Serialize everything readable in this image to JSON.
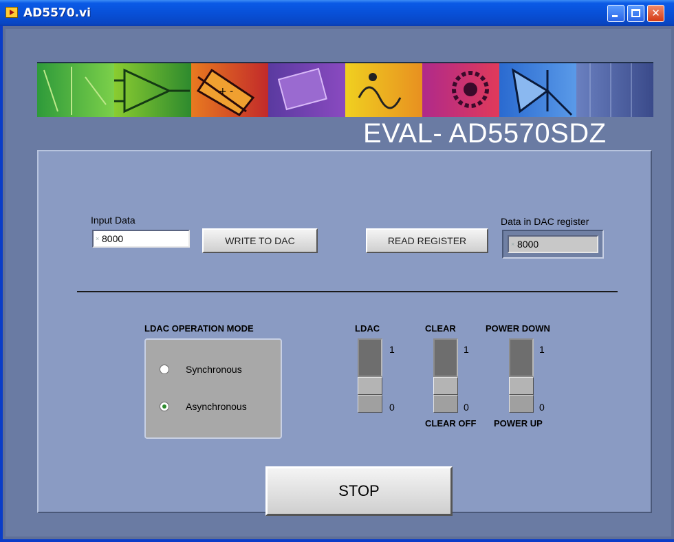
{
  "window": {
    "title": "AD5570.vi"
  },
  "banner": {
    "heading": "EVAL- AD5570SDZ"
  },
  "input_data": {
    "label": "Input Data",
    "value": "8000"
  },
  "write_button": {
    "label": "WRITE TO DAC"
  },
  "read_button": {
    "label": "READ REGISTER"
  },
  "dac_register": {
    "label": "Data in DAC register",
    "value": "8000"
  },
  "ldac_mode": {
    "label": "LDAC OPERATION MODE",
    "options": [
      "Synchronous",
      "Asynchronous"
    ],
    "selected": "Asynchronous"
  },
  "switches": [
    {
      "label": "LDAC",
      "high": "1",
      "low": "0",
      "low_caption": "",
      "state": "0"
    },
    {
      "label": "CLEAR",
      "high": "1",
      "low": "0",
      "low_caption": "CLEAR OFF",
      "state": "0"
    },
    {
      "label": "POWER DOWN",
      "high": "1",
      "low": "0",
      "low_caption": "POWER UP",
      "state": "0"
    }
  ],
  "stop_button": {
    "label": "STOP"
  },
  "colors": {
    "titlebar": "#0850d8",
    "panel": "#8a9bc3",
    "background": "#6a7ba3",
    "radio_selected": "#2e8b2e"
  },
  "icons": [
    "labview-vi-icon",
    "minimize-icon",
    "maximize-icon",
    "close-icon"
  ]
}
